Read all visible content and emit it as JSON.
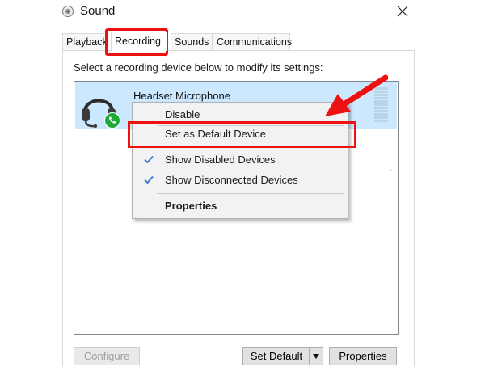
{
  "window": {
    "title": "Sound",
    "close_glyph": "✕",
    "icon": "speaker-icon"
  },
  "tabs": [
    {
      "label": "Playback",
      "active": false
    },
    {
      "label": "Recording",
      "active": true
    },
    {
      "label": "Sounds",
      "active": false
    },
    {
      "label": "Communications",
      "active": false
    }
  ],
  "recording": {
    "instruction": "Select a recording device below to modify its settings:",
    "device": {
      "name": "Headset Microphone",
      "icon": "headset-icon",
      "status_icon": "default-communications-phone-icon",
      "selected": true
    }
  },
  "context_menu": {
    "items": [
      {
        "label": "Disable",
        "checked": false,
        "bold": false
      },
      {
        "label": "Set as Default Device",
        "checked": false,
        "bold": false
      },
      {
        "label": "Show Disabled Devices",
        "checked": true,
        "bold": false
      },
      {
        "label": "Show Disconnected Devices",
        "checked": true,
        "bold": false
      },
      {
        "label": "Properties",
        "checked": false,
        "bold": true
      }
    ]
  },
  "buttons": {
    "configure": "Configure",
    "set_default": "Set Default",
    "properties": "Properties"
  },
  "colors": {
    "highlight": "#ee1111",
    "selection": "#cce8ff",
    "check": "#2f7bd8",
    "phone_badge": "#1faa3a"
  }
}
